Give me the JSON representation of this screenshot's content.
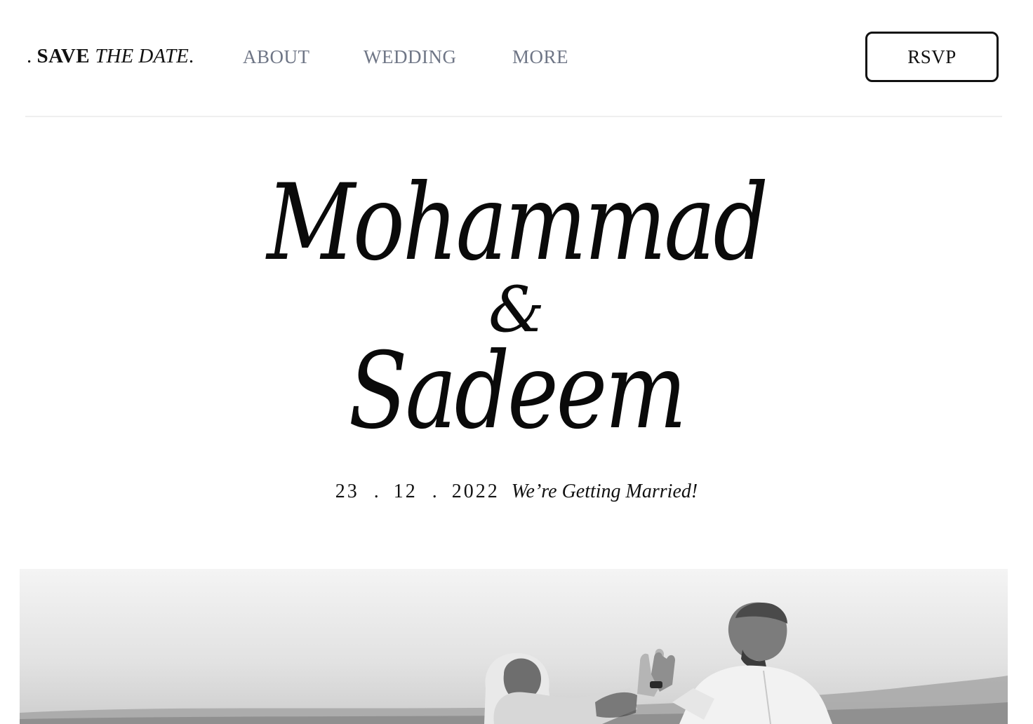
{
  "header": {
    "brand": {
      "prefix": ".",
      "save": "SAVE",
      "the_date": "THE DATE",
      "suffix": "."
    },
    "nav": [
      {
        "label": "ABOUT"
      },
      {
        "label": "WEDDING"
      },
      {
        "label": "MORE"
      }
    ],
    "rsvp_label": "RSVP"
  },
  "hero": {
    "name_first": "Mohammad",
    "ampersand": "&",
    "name_second": "Sadeem",
    "date": {
      "day": "23",
      "month": "12",
      "year": "2022",
      "separator": "."
    },
    "tagline": "We’re Getting Married!"
  },
  "colors": {
    "text": "#111111",
    "nav": "#6f7686",
    "divider": "#efefef",
    "background": "#ffffff"
  }
}
